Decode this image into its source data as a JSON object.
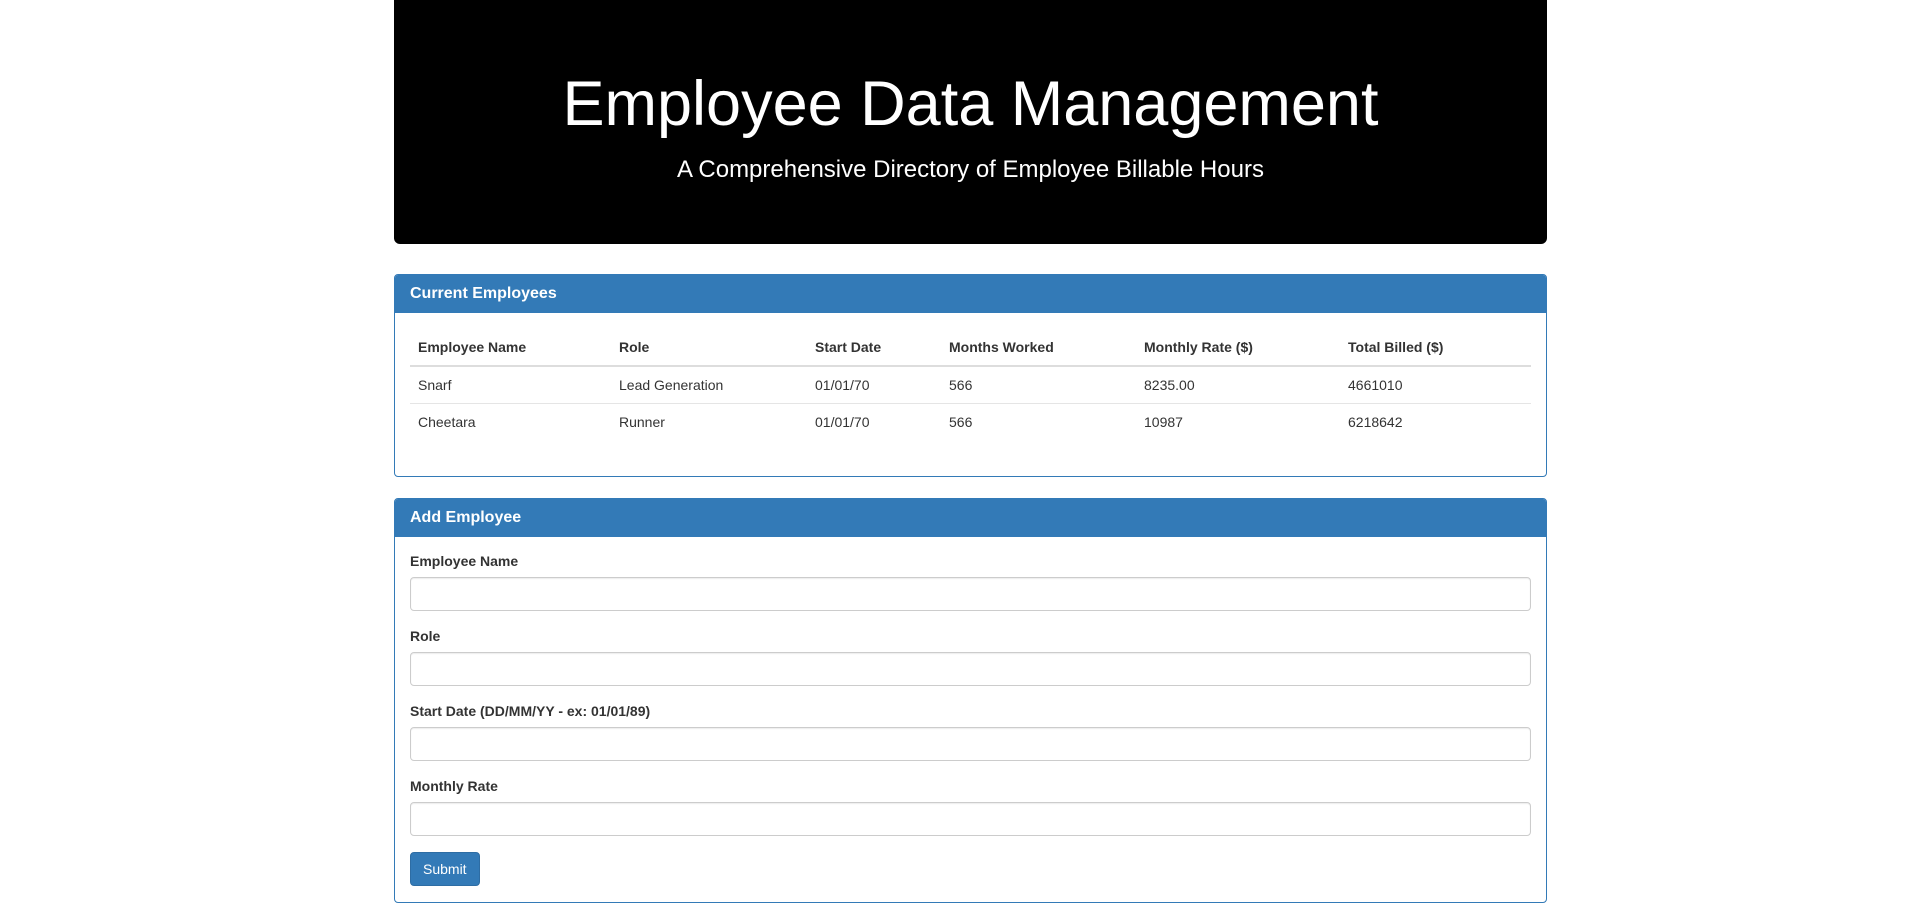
{
  "header": {
    "title": "Employee Data Management",
    "subtitle": "A Comprehensive Directory of Employee Billable Hours"
  },
  "employees_panel": {
    "title": "Current Employees",
    "columns": [
      "Employee Name",
      "Role",
      "Start Date",
      "Months Worked",
      "Monthly Rate ($)",
      "Total Billed ($)"
    ],
    "rows": [
      [
        "Snarf",
        "Lead Generation",
        "01/01/70",
        "566",
        "8235.00",
        "4661010"
      ],
      [
        "Cheetara",
        "Runner",
        "01/01/70",
        "566",
        "10987",
        "6218642"
      ]
    ]
  },
  "add_panel": {
    "title": "Add Employee",
    "fields": [
      {
        "label": "Employee Name",
        "value": "",
        "placeholder": ""
      },
      {
        "label": "Role",
        "value": "",
        "placeholder": ""
      },
      {
        "label": "Start Date (DD/MM/YY - ex: 01/01/89)",
        "value": "",
        "placeholder": ""
      },
      {
        "label": "Monthly Rate",
        "value": "",
        "placeholder": ""
      }
    ],
    "submit_label": "Submit"
  },
  "colors": {
    "jumbotron_bg": "#000000",
    "panel_primary": "#337ab7"
  }
}
